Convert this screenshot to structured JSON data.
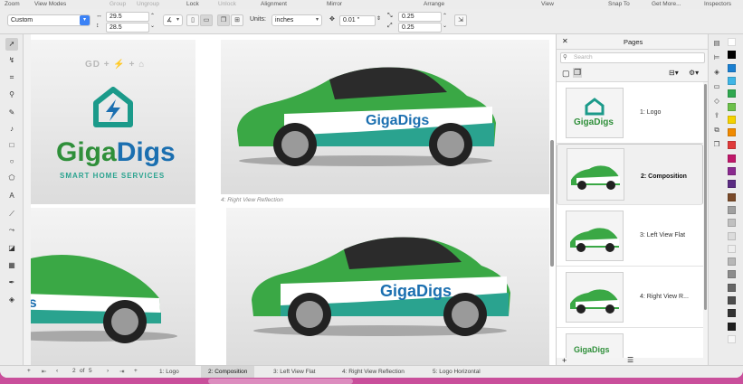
{
  "menu_labels": [
    {
      "text": "Zoom",
      "dim": false
    },
    {
      "text": "View Modes",
      "dim": false
    },
    {
      "text": "Group",
      "dim": true
    },
    {
      "text": "Ungroup",
      "dim": true
    },
    {
      "text": "Lock",
      "dim": false
    },
    {
      "text": "Unlock",
      "dim": true
    },
    {
      "text": "Alignment",
      "dim": false
    },
    {
      "text": "Mirror",
      "dim": false
    },
    {
      "text": "Arrange",
      "dim": false
    },
    {
      "text": "View",
      "dim": false
    },
    {
      "text": "Snap To",
      "dim": false
    },
    {
      "text": "Get More...",
      "dim": false
    },
    {
      "text": "Inspectors",
      "dim": false
    }
  ],
  "propbar": {
    "page_preset": "Custom",
    "width": "29.5",
    "height": "28.5",
    "units_label": "Units:",
    "units_value": "inches",
    "nudge": "0.01 \"",
    "dup_x": "0.25",
    "dup_y": "0.25"
  },
  "canvas": {
    "logo_top": "GD + ⚡ + ⌂",
    "brand_name_1": "Giga",
    "brand_name_2": "Digs",
    "brand_tagline": "SMART HOME SERVICES",
    "caption_right_view": "4: Right View Reflection"
  },
  "pages_panel": {
    "title": "Pages",
    "search_placeholder": "Search",
    "items": [
      {
        "name": "1: Logo",
        "selected": false
      },
      {
        "name": "2: Composition",
        "selected": true
      },
      {
        "name": "3: Left View Flat",
        "selected": false
      },
      {
        "name": "4: Right View R...",
        "selected": false
      },
      {
        "name": "",
        "selected": false
      }
    ]
  },
  "bottom_bar": {
    "page_current": "2",
    "page_of": "of",
    "page_total": "5",
    "tabs": [
      {
        "label": "1: Logo",
        "active": false
      },
      {
        "label": "2: Composition",
        "active": true
      },
      {
        "label": "3: Left View Flat",
        "active": false
      },
      {
        "label": "4: Right View Reflection",
        "active": false
      },
      {
        "label": "5: Logo Horizontal",
        "active": false
      }
    ]
  },
  "palette_colors": [
    "#ffffff",
    "#000000",
    "#1a7fd1",
    "#3fb5e6",
    "#2fa84f",
    "#6cc04a",
    "#f4d200",
    "#f08a00",
    "#e03a3a",
    "#c0186a",
    "#8a2a8f",
    "#5b2c83",
    "#7a4a2a",
    "#a0a0a0",
    "#c0c0c0",
    "#dcdcdc",
    "#eeeeee",
    "#b7b7b7",
    "#8c8c8c",
    "#666666",
    "#4d4d4d",
    "#333333",
    "#1f1f1f",
    "#f7f7f7"
  ],
  "colors": {
    "brand_green": "#2f8f3a",
    "brand_blue": "#1b6fb0",
    "accent": "#3b82f6"
  }
}
